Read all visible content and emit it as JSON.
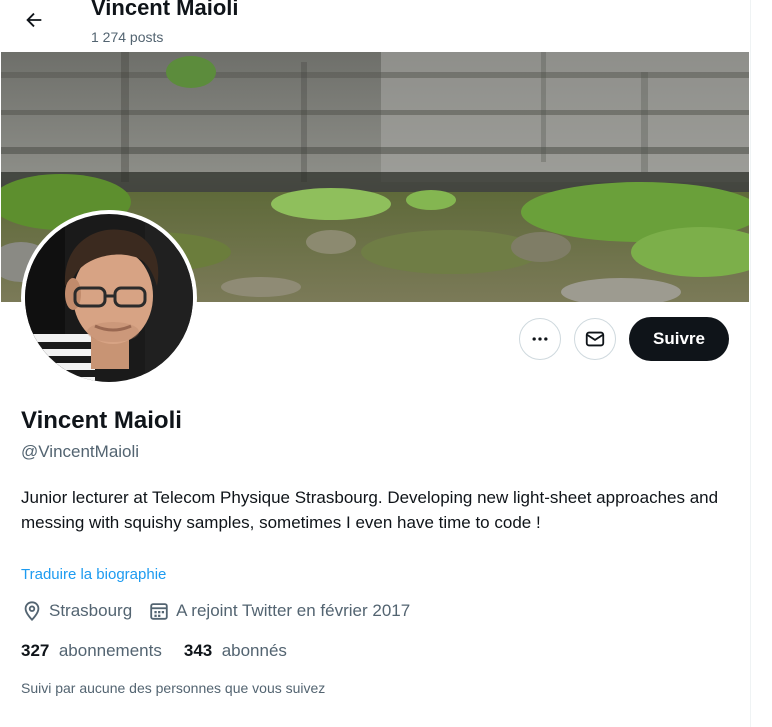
{
  "header": {
    "title": "Vincent Maioli",
    "posts_count": "1 274 posts"
  },
  "profile": {
    "name": "Vincent Maioli",
    "handle": "@VincentMaioli",
    "bio": "Junior lecturer at Telecom Physique Strasbourg. Developing new light-sheet approaches and messing with squishy samples, sometimes I even have time to code !",
    "translate_link": "Traduire la biographie",
    "location": "Strasbourg",
    "joined": "A rejoint Twitter en février 2017",
    "following_count": "327",
    "following_label": "abonnements",
    "followers_count": "343",
    "followers_label": "abonnés",
    "followed_by": "Suivi par aucune des personnes que vous suivez"
  },
  "actions": {
    "follow_label": "Suivre",
    "more_icon": "more-horizontal-icon",
    "message_icon": "envelope-icon"
  },
  "colors": {
    "link": "#1d9bf0",
    "text_primary": "#0f1419",
    "text_secondary": "#536471",
    "follow_bg": "#0f1419"
  }
}
